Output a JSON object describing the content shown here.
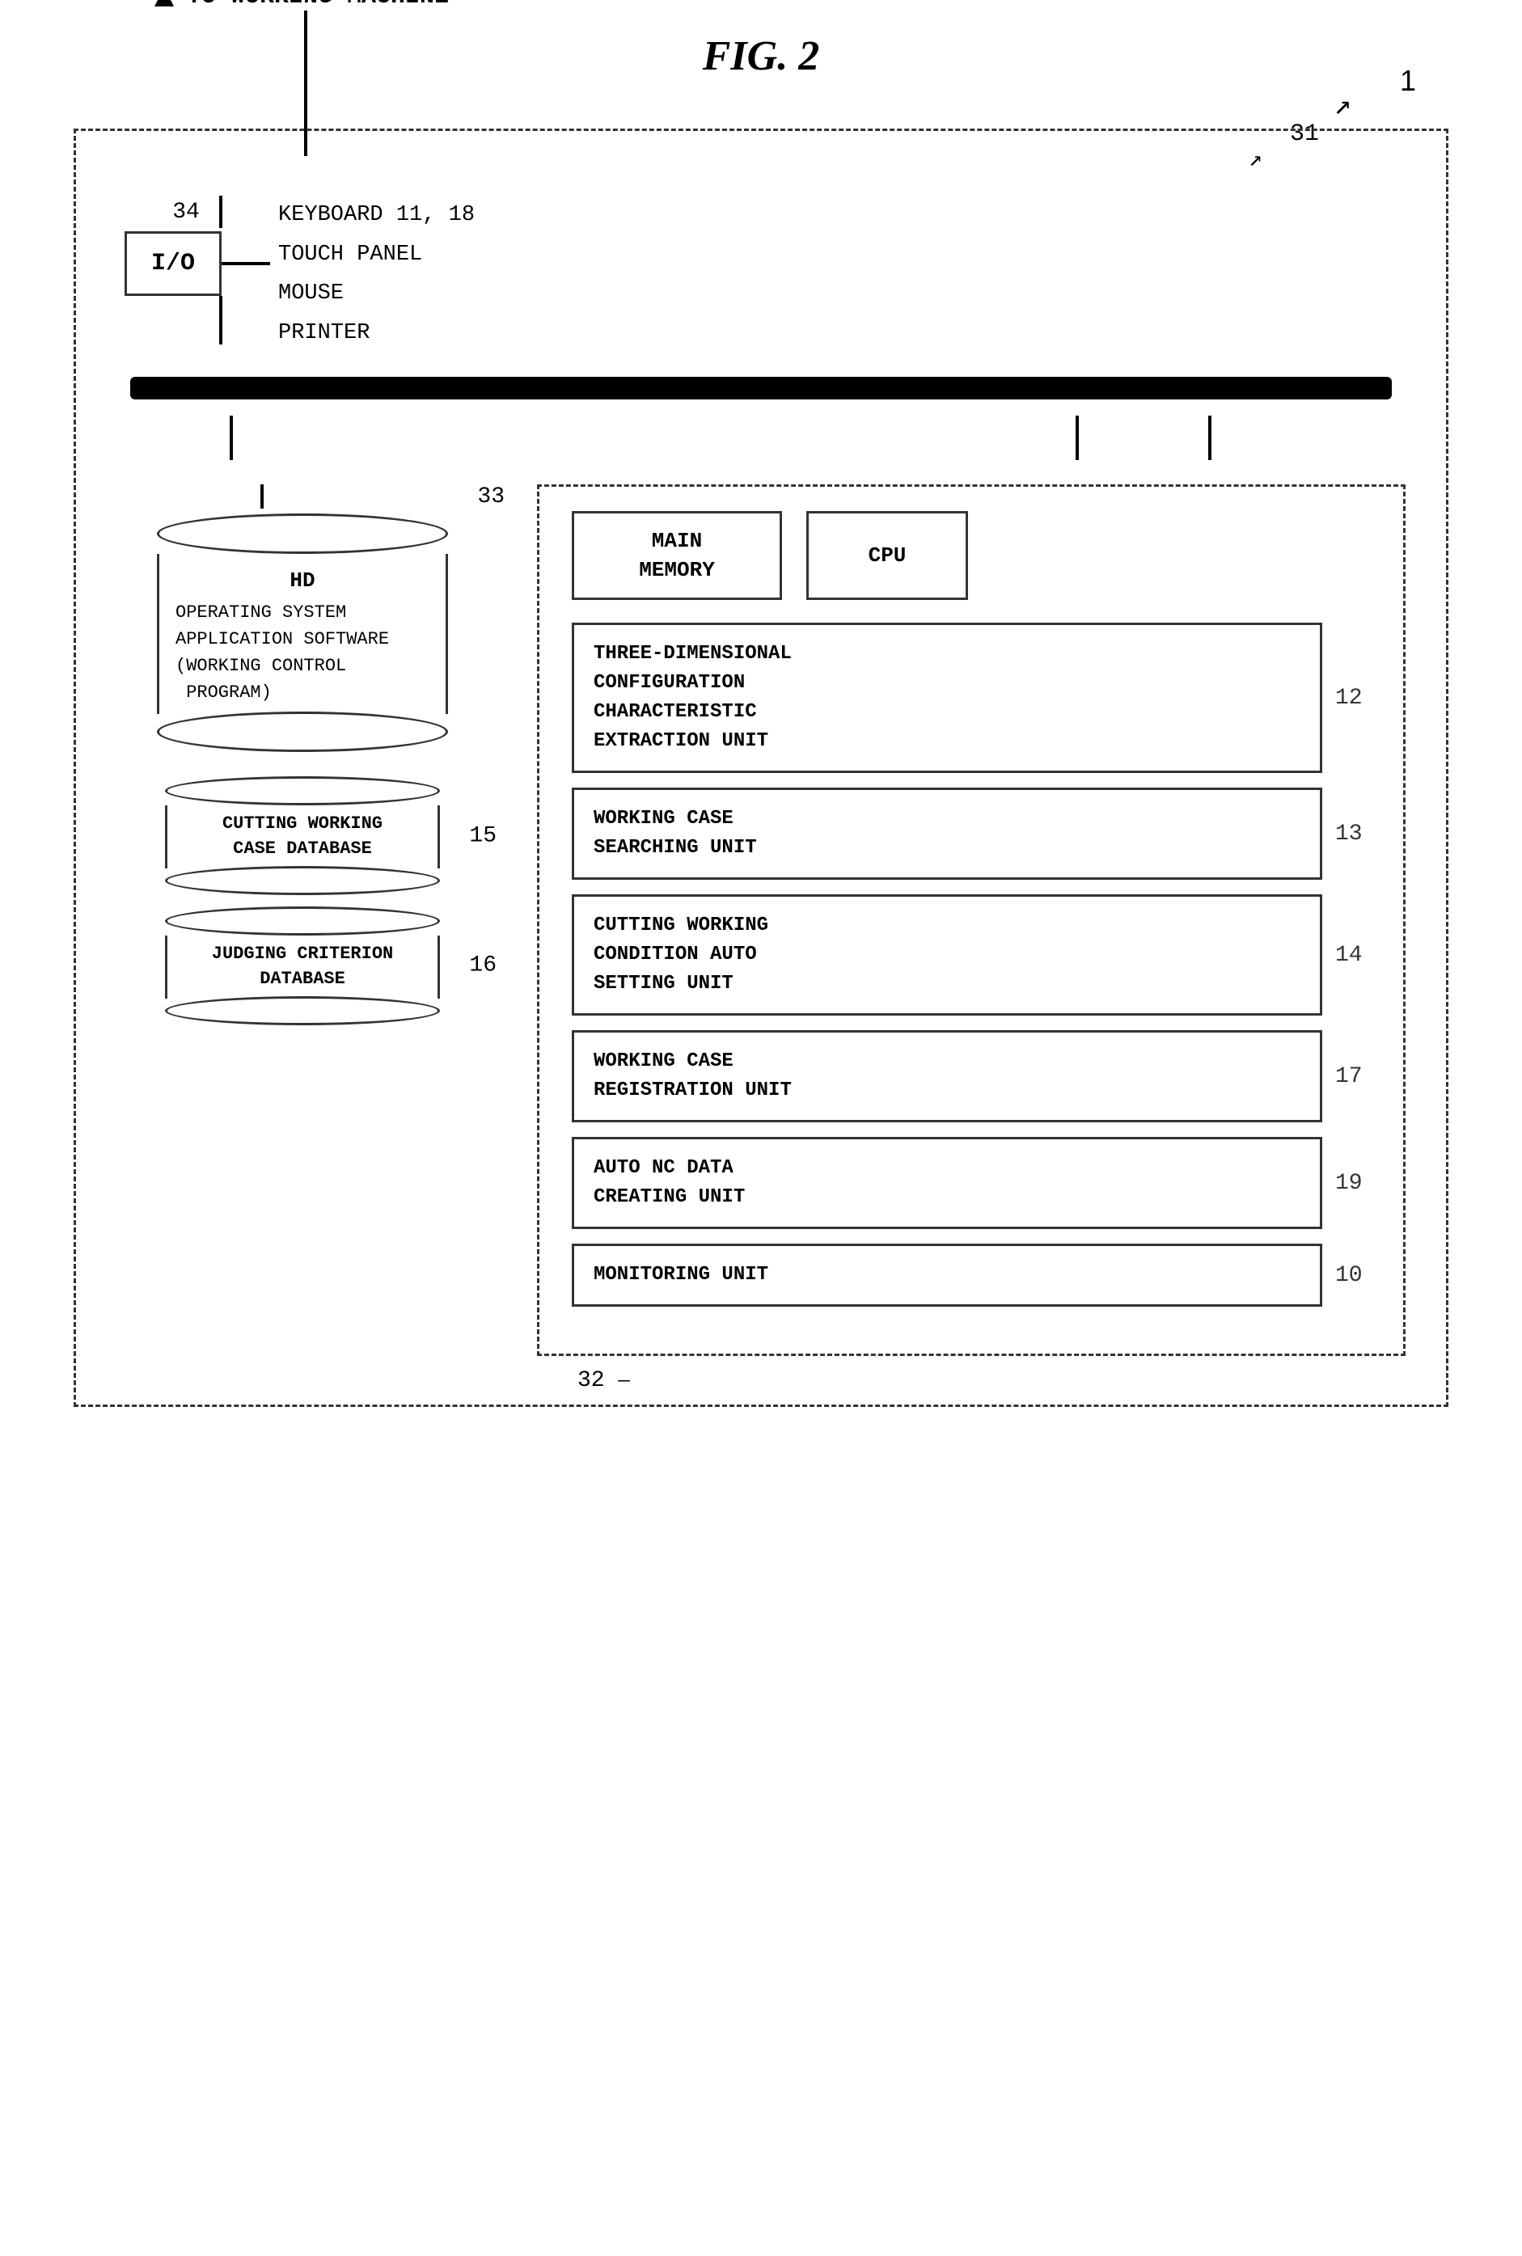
{
  "title": "FIG. 2",
  "labels": {
    "ref1": "1",
    "ref31": "31",
    "ref32": "32",
    "ref33": "33",
    "ref34": "34",
    "ref12": "12",
    "ref13": "13",
    "ref14": "14",
    "ref15": "15",
    "ref16": "16",
    "ref17": "17",
    "ref19": "19",
    "ref10": "10"
  },
  "to_working_machine": "TO WORKING MACHINE",
  "io_label": "I/O",
  "devices": [
    "KEYBOARD 11, 18",
    "TOUCH PANEL",
    "MOUSE",
    "PRINTER"
  ],
  "hd_label": "HD",
  "hd_software": "OPERATING SYSTEM\nAPPLICATION SOFTWARE\n(WORKING CONTROL\n PROGRAM)",
  "db1_label": "CUTTING WORKING\nCASE DATABASE",
  "db2_label": "JUDGING CRITERION\nDATABASE",
  "components": {
    "main_memory": "MAIN\nMEMORY",
    "cpu": "CPU",
    "unit12": "THREE-DIMENSIONAL\nCONFIGURATION\nCHARACTERISTIC\nEXTRACTION UNIT",
    "unit13": "WORKING CASE\nSEARCHING UNIT",
    "unit14": "CUTTING WORKING\nCONDITION AUTO\nSETTING UNIT",
    "unit17": "WORKING CASE\nREGISTRATION UNIT",
    "unit19": "AUTO NC DATA\nCREATING UNIT",
    "unit10": "MONITORING UNIT"
  }
}
